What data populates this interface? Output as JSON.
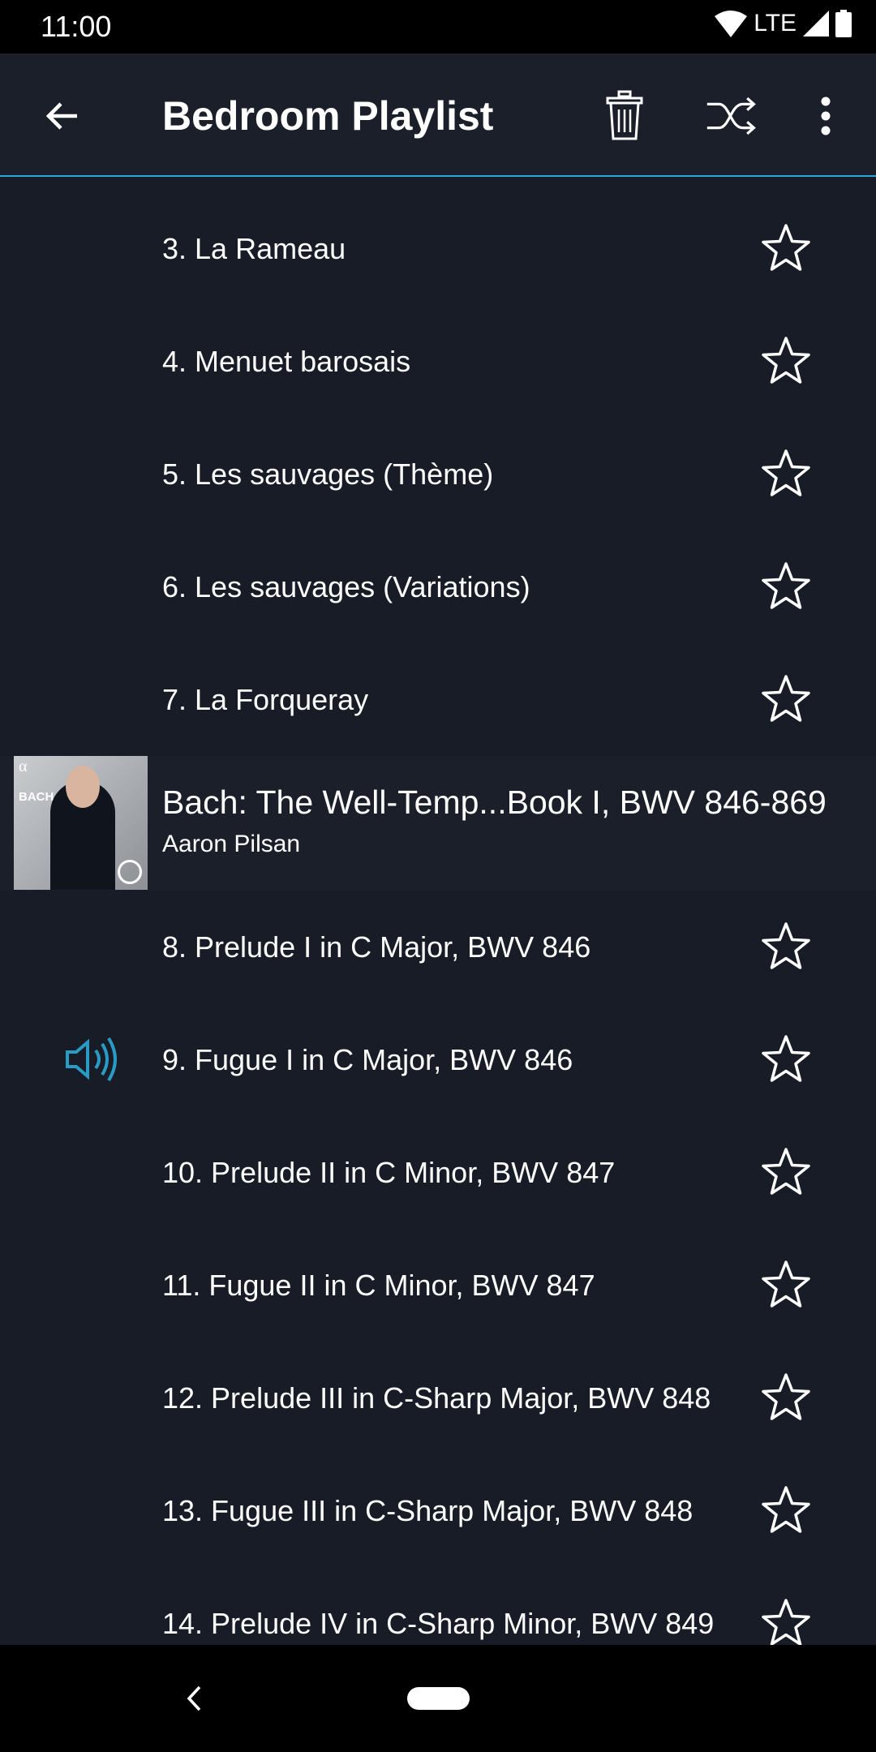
{
  "status_bar": {
    "time": "11:00",
    "network": "LTE",
    "icons": [
      "wifi-icon",
      "signal-icon",
      "battery-icon"
    ]
  },
  "app_bar": {
    "title": "Bedroom Playlist",
    "icons": [
      "back-arrow-icon",
      "trash-icon",
      "shuffle-icon",
      "more-vert-icon"
    ]
  },
  "colors": {
    "accent": "#2aa7d6",
    "background": "#171c26",
    "app_bar": "#1b1f2a"
  },
  "tracks_before": [
    {
      "label": "3. La Rameau"
    },
    {
      "label": "4. Menuet barosais"
    },
    {
      "label": "5. Les sauvages (Thème)"
    },
    {
      "label": "6. Les sauvages (Variations)"
    },
    {
      "label": "7. La Forqueray"
    }
  ],
  "album": {
    "title": "Bach: The Well-Temp...Book I, BWV 846-869",
    "artist": "Aaron Pilsan",
    "cover_text": "BACH"
  },
  "tracks_after": [
    {
      "label": "8. Prelude I in C Major, BWV 846",
      "playing": false
    },
    {
      "label": "9. Fugue I in C Major, BWV 846",
      "playing": true
    },
    {
      "label": "10. Prelude II in C Minor, BWV 847",
      "playing": false
    },
    {
      "label": "11. Fugue II in C Minor, BWV 847",
      "playing": false
    },
    {
      "label": "12. Prelude III in C-Sharp Major, BWV 848",
      "playing": false
    },
    {
      "label": "13. Fugue III in C-Sharp Major, BWV 848",
      "playing": false
    },
    {
      "label": "14. Prelude IV in C-Sharp Minor, BWV 849",
      "playing": false
    }
  ]
}
